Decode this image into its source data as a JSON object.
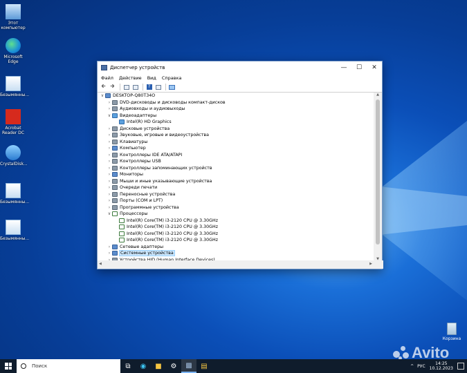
{
  "desktop": {
    "icons": [
      {
        "label": "Этот\nкомпьютер",
        "icon": "this-pc-icon"
      },
      {
        "label": "Microsoft\nEdge",
        "icon": "edge-icon"
      },
      {
        "label": "Безымянны...",
        "icon": "image-file-icon"
      },
      {
        "label": "Acrobat\nReader DC",
        "icon": "acrobat-icon"
      },
      {
        "label": "CrystalDisk...",
        "icon": "crystaldisk-icon"
      },
      {
        "label": "Безымянны...",
        "icon": "image-file-icon"
      },
      {
        "label": "Безымянны...",
        "icon": "image-file-icon"
      }
    ],
    "recycle_bin": "Корзина"
  },
  "window": {
    "title": "Диспетчер устройств",
    "menu": [
      "Файл",
      "Действие",
      "Вид",
      "Справка"
    ],
    "tree": [
      {
        "text": "DESKTOP-Q80T34O",
        "level": 0,
        "expanded": true,
        "icon": "pc"
      },
      {
        "text": "DVD-дисководы и дисководы компакт-дисков",
        "level": 1,
        "expanded": false,
        "icon": "gen"
      },
      {
        "text": "Аудиовходы и аудиовыходы",
        "level": 1,
        "expanded": false,
        "icon": "gen"
      },
      {
        "text": "Видеоадаптеры",
        "level": 1,
        "expanded": true,
        "icon": "gpu"
      },
      {
        "text": "Intel(R) HD Graphics",
        "level": 2,
        "icon": "gpu"
      },
      {
        "text": "Дисковые устройства",
        "level": 1,
        "expanded": false,
        "icon": "gen"
      },
      {
        "text": "Звуковые, игровые и видеоустройства",
        "level": 1,
        "expanded": false,
        "icon": "gen"
      },
      {
        "text": "Клавиатуры",
        "level": 1,
        "expanded": false,
        "icon": "gen"
      },
      {
        "text": "Компьютер",
        "level": 1,
        "expanded": false,
        "icon": "pc"
      },
      {
        "text": "Контроллеры IDE ATA/ATAPI",
        "level": 1,
        "expanded": false,
        "icon": "gen"
      },
      {
        "text": "Контроллеры USB",
        "level": 1,
        "expanded": false,
        "icon": "gen"
      },
      {
        "text": "Контроллеры запоминающих устройств",
        "level": 1,
        "expanded": false,
        "icon": "gen"
      },
      {
        "text": "Мониторы",
        "level": 1,
        "expanded": false,
        "icon": "pc"
      },
      {
        "text": "Мыши и иные указывающие устройства",
        "level": 1,
        "expanded": false,
        "icon": "gen"
      },
      {
        "text": "Очереди печати",
        "level": 1,
        "expanded": false,
        "icon": "gen"
      },
      {
        "text": "Переносные устройства",
        "level": 1,
        "expanded": false,
        "icon": "gen"
      },
      {
        "text": "Порты (COM и LPT)",
        "level": 1,
        "expanded": false,
        "icon": "gen"
      },
      {
        "text": "Программные устройства",
        "level": 1,
        "expanded": false,
        "icon": "gen"
      },
      {
        "text": "Процессоры",
        "level": 1,
        "expanded": true,
        "icon": "cpu"
      },
      {
        "text": "Intel(R) Core(TM) i3-2120 CPU @ 3.30GHz",
        "level": 2,
        "icon": "cpu"
      },
      {
        "text": "Intel(R) Core(TM) i3-2120 CPU @ 3.30GHz",
        "level": 2,
        "icon": "cpu"
      },
      {
        "text": "Intel(R) Core(TM) i3-2120 CPU @ 3.30GHz",
        "level": 2,
        "icon": "cpu"
      },
      {
        "text": "Intel(R) Core(TM) i3-2120 CPU @ 3.30GHz",
        "level": 2,
        "icon": "cpu"
      },
      {
        "text": "Сетевые адаптеры",
        "level": 1,
        "expanded": false,
        "icon": "pc"
      },
      {
        "text": "Системные устройства",
        "level": 1,
        "expanded": false,
        "icon": "pc",
        "selected": true
      },
      {
        "text": "Устройства HID (Human Interface Devices)",
        "level": 1,
        "expanded": false,
        "icon": "gen"
      }
    ]
  },
  "taskbar": {
    "search_placeholder": "Поиск",
    "lang": "РУС",
    "time": "14:25",
    "date": "10.12.2023"
  },
  "watermark": "Avito"
}
